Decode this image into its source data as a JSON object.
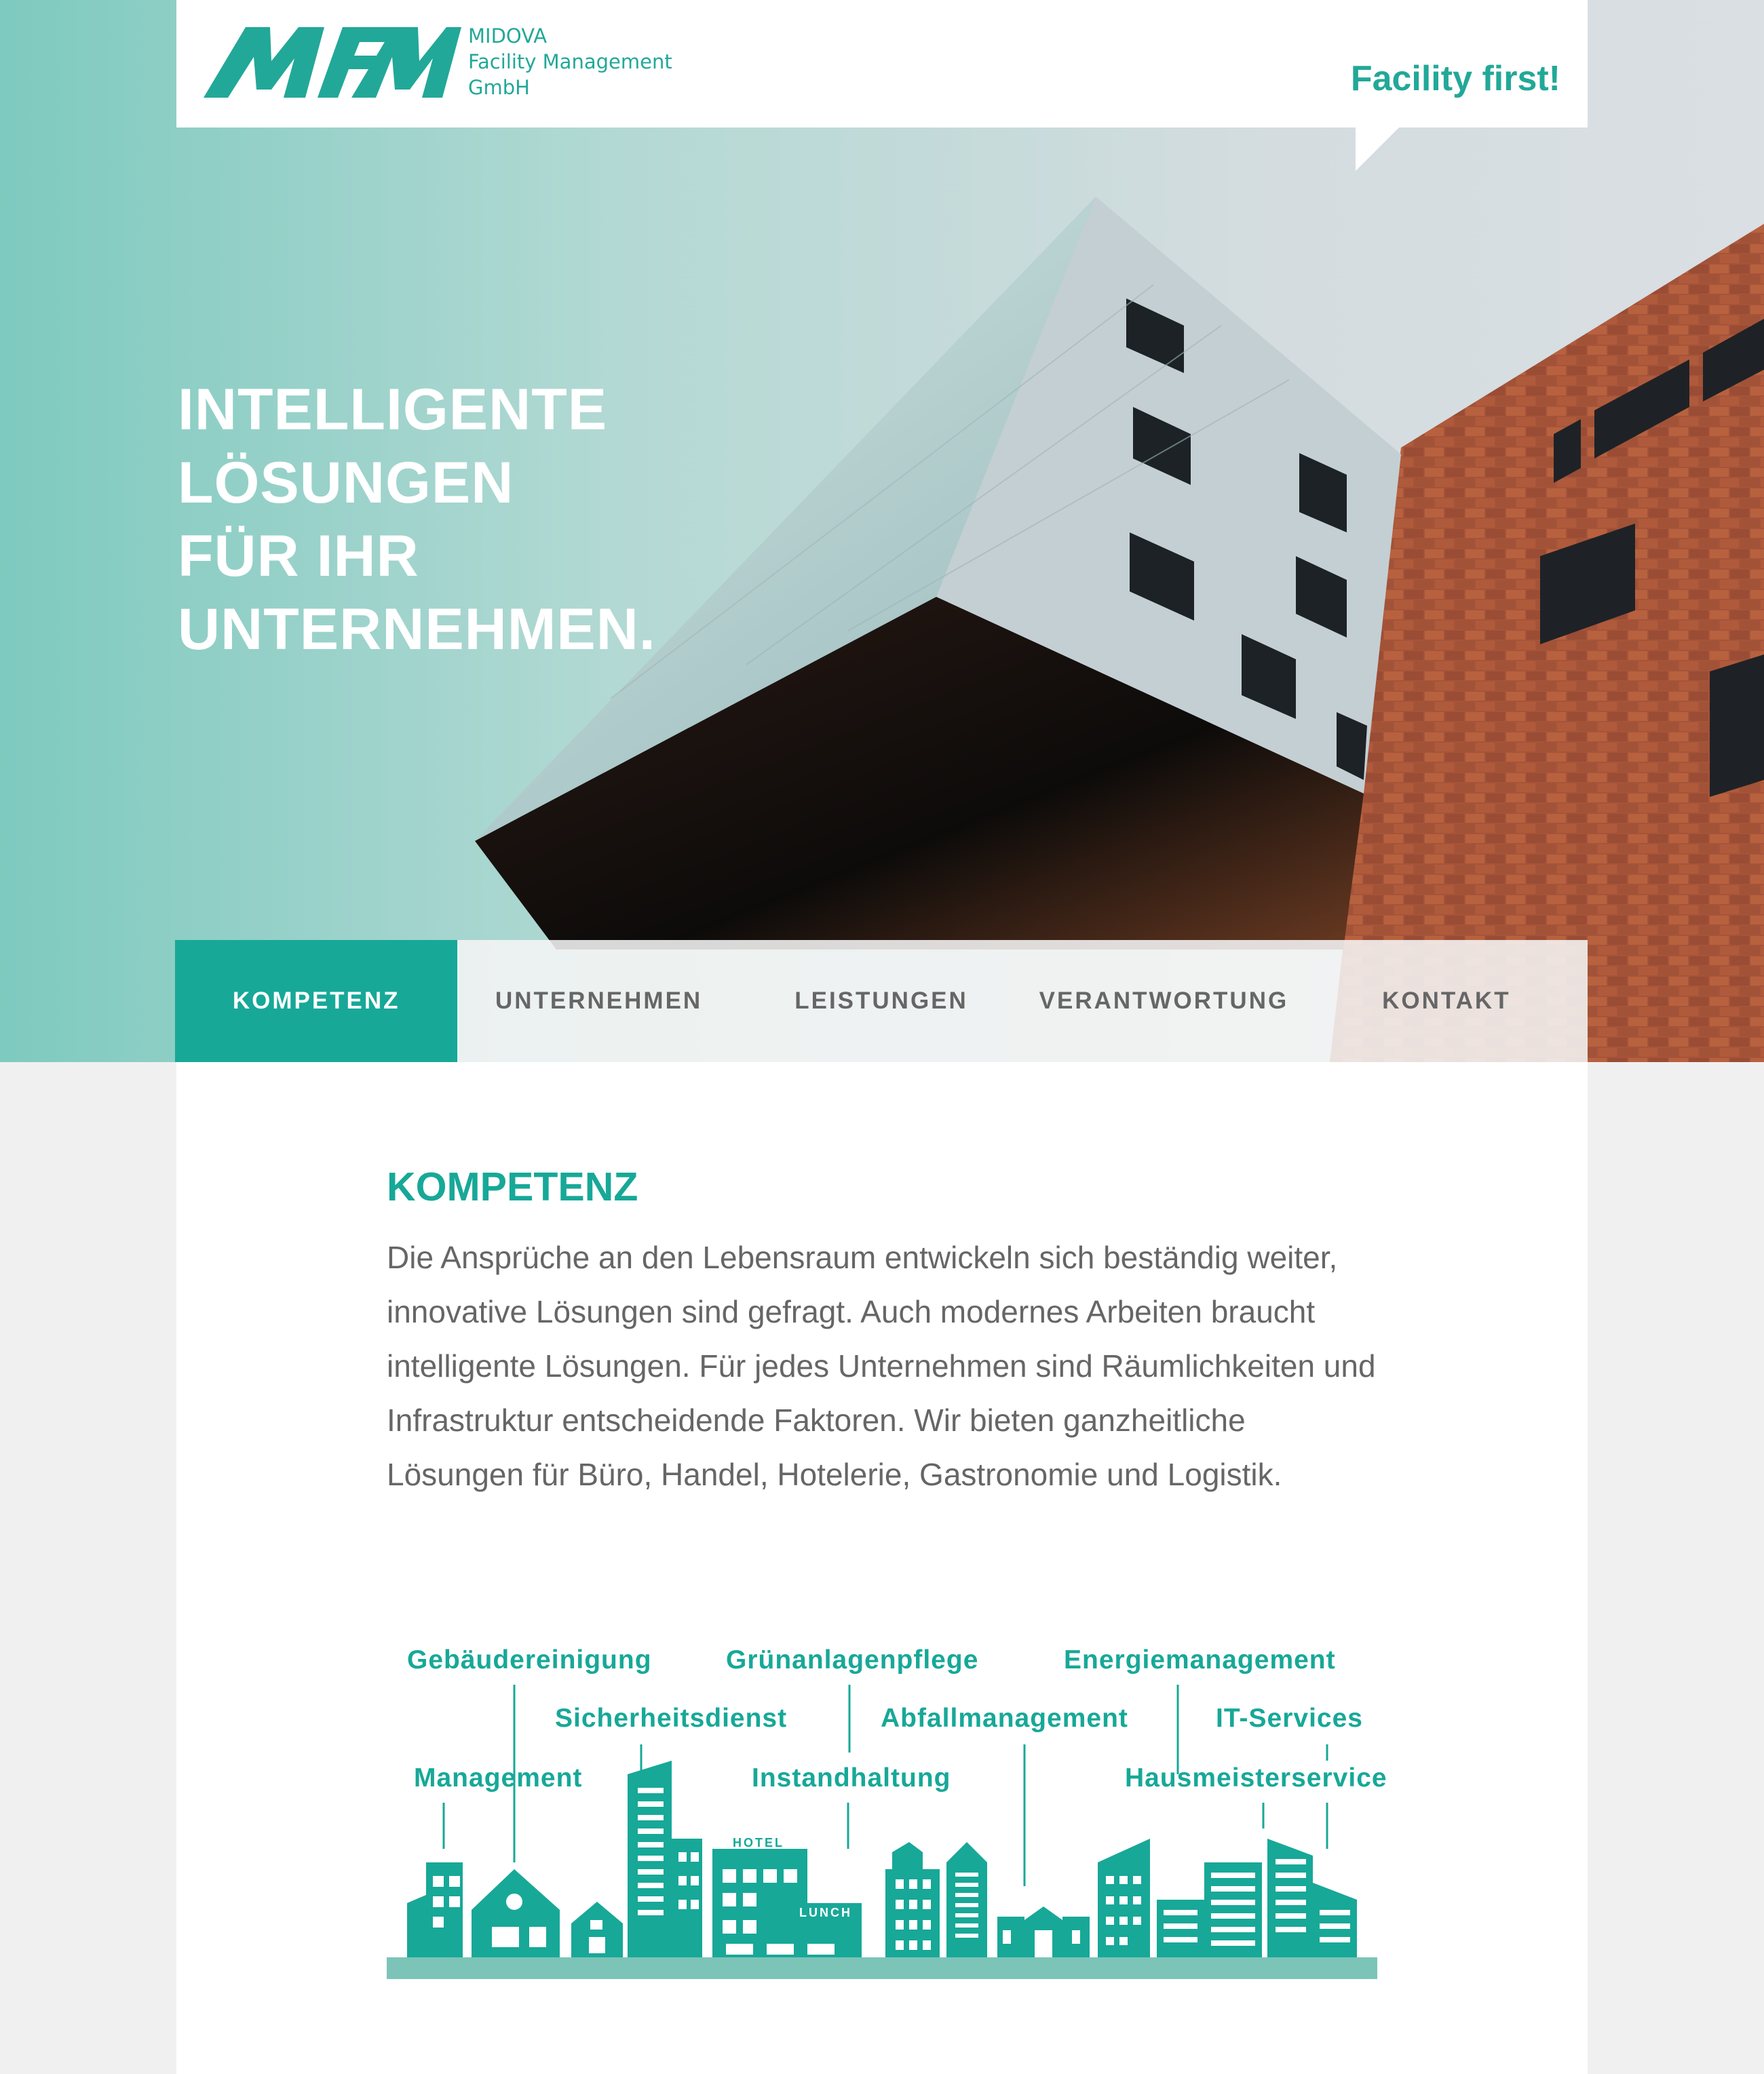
{
  "brand": {
    "logo_letters": "MFM",
    "company_lines": [
      "MIDOVA",
      "Facility Management",
      "GmbH"
    ],
    "tagline": "Facility first!",
    "accent_color": "#17a898"
  },
  "hero": {
    "headline_lines": [
      "INTELLIGENTE",
      "LÖSUNGEN",
      "FÜR IHR",
      "UNTERNEHMEN."
    ]
  },
  "nav": {
    "items": [
      {
        "label": "KOMPETENZ",
        "active": true
      },
      {
        "label": "UNTERNEHMEN",
        "active": false
      },
      {
        "label": "LEISTUNGEN",
        "active": false
      },
      {
        "label": "VERANTWORTUNG",
        "active": false
      },
      {
        "label": "KONTAKT",
        "active": false
      }
    ]
  },
  "content": {
    "title": "KOMPETENZ",
    "paragraph": "Die Ansprüche an den Lebensraum entwickeln sich beständig weiter, innovative Lösungen sind gefragt. Auch modernes Arbeiten braucht intelligente Lösungen. Für jedes Unternehmen sind Räumlichkeiten und Infrastruktur entscheidende Faktoren. Wir bieten ganzheitliche Lösungen für Büro, Handel, Hotelerie, Gastronomie und Logistik."
  },
  "illustration": {
    "services": [
      "Gebäudereinigung",
      "Grünanlagenpflege",
      "Energiemanagement",
      "Sicherheitsdienst",
      "Abfallmanagement",
      "IT-Services",
      "Management",
      "Instandhaltung",
      "Hausmeisterservice"
    ],
    "signs": {
      "hotel": "HOTEL",
      "lunch": "LUNCH"
    }
  }
}
